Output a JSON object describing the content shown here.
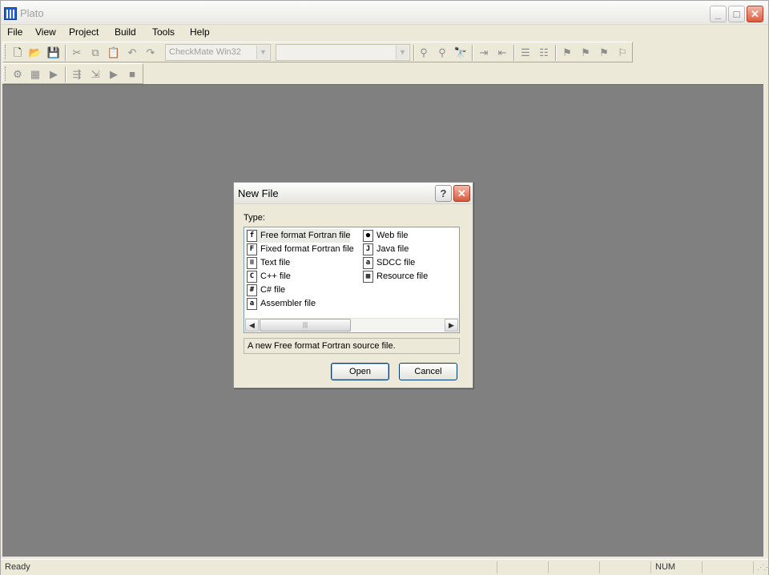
{
  "window": {
    "title": "Plato"
  },
  "menu": [
    "File",
    "View",
    "Project",
    "Build",
    "Tools",
    "Help"
  ],
  "toolbar": {
    "config_combo": "CheckMate Win32",
    "second_combo": ""
  },
  "dialog": {
    "title": "New File",
    "type_label": "Type:",
    "types_col1": [
      {
        "label": "Free format Fortran file",
        "icon": "fortran-free-icon",
        "glyph": "f"
      },
      {
        "label": "Fixed format Fortran file",
        "icon": "fortran-fixed-icon",
        "glyph": "F"
      },
      {
        "label": "Text file",
        "icon": "text-file-icon",
        "glyph": "≡"
      },
      {
        "label": "C++ file",
        "icon": "cpp-file-icon",
        "glyph": "C"
      },
      {
        "label": "C# file",
        "icon": "csharp-file-icon",
        "glyph": "#"
      },
      {
        "label": "Assembler file",
        "icon": "assembler-file-icon",
        "glyph": "a"
      }
    ],
    "types_col2": [
      {
        "label": "Web file",
        "icon": "web-file-icon",
        "glyph": "●"
      },
      {
        "label": "Java file",
        "icon": "java-file-icon",
        "glyph": "J"
      },
      {
        "label": "SDCC file",
        "icon": "sdcc-file-icon",
        "glyph": "a"
      },
      {
        "label": "Resource file",
        "icon": "resource-file-icon",
        "glyph": "▦"
      }
    ],
    "selected": "Free format Fortran file",
    "description": "A new Free format Fortran source file.",
    "open_label": "Open",
    "cancel_label": "Cancel"
  },
  "status": {
    "text": "Ready",
    "num": "NUM"
  }
}
